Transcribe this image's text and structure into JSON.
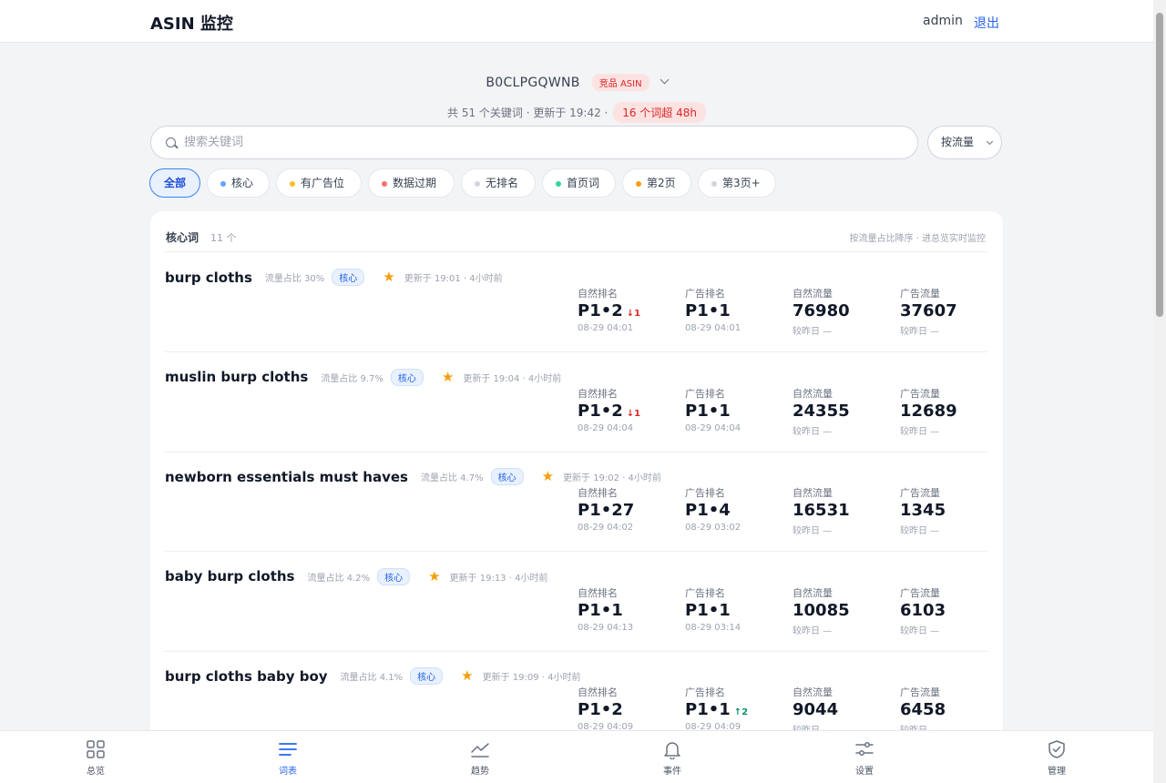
{
  "header": {
    "title": "ASIN 监控",
    "user": "admin",
    "logout_label": "退出"
  },
  "asin": {
    "code": "B0CLPGQWNB",
    "badge": "竞品 ASIN"
  },
  "summary": {
    "text": "共 51 个关键词 · 更新于 19:42 ·",
    "overdue": "16 个词超 48h"
  },
  "search": {
    "placeholder": "搜索关键词"
  },
  "sort": {
    "label": "按流量"
  },
  "filters": [
    {
      "label": "全部",
      "dot": "",
      "active": true
    },
    {
      "label": "核心",
      "dot": "#60a5fa"
    },
    {
      "label": "有广告位",
      "dot": "#fbbf24"
    },
    {
      "label": "数据过期",
      "dot": "#f87171"
    },
    {
      "label": "无排名",
      "dot": "#d1d5db"
    },
    {
      "label": "首页词",
      "dot": "#34d399"
    },
    {
      "label": "第2页",
      "dot": "#f59e0b"
    },
    {
      "label": "第3页+",
      "dot": "#d1d5db"
    }
  ],
  "section": {
    "title": "核心词",
    "count": "11 个",
    "hint": "按流量占比降序 · 进总览实时监控"
  },
  "columns": {
    "natural_rank": "自然排名",
    "ad_rank": "广告排名",
    "natural_traffic": "自然流量",
    "ad_traffic": "广告流量"
  },
  "keywords": [
    {
      "name": "burp cloths",
      "share": "流量占比 30%",
      "tag": "核心",
      "updated": "更新于 19:01 · 4小时前",
      "natural_rank": "P1•2",
      "natural_delta": "↓1",
      "natural_delta_dir": "down",
      "natural_time": "08-29 04:01",
      "ad_rank": "P1•1",
      "ad_delta": "",
      "ad_delta_dir": "",
      "ad_time": "08-29 04:01",
      "natural_traffic": "76980",
      "natural_traffic_sub": "较昨日 —",
      "ad_traffic": "37607",
      "ad_traffic_sub": "较昨日 —"
    },
    {
      "name": "muslin burp cloths",
      "share": "流量占比 9.7%",
      "tag": "核心",
      "updated": "更新于 19:04 · 4小时前",
      "natural_rank": "P1•2",
      "natural_delta": "↓1",
      "natural_delta_dir": "down",
      "natural_time": "08-29 04:04",
      "ad_rank": "P1•1",
      "ad_delta": "",
      "ad_delta_dir": "",
      "ad_time": "08-29 04:04",
      "natural_traffic": "24355",
      "natural_traffic_sub": "较昨日 —",
      "ad_traffic": "12689",
      "ad_traffic_sub": "较昨日 —"
    },
    {
      "name": "newborn essentials must haves",
      "share": "流量占比 4.7%",
      "tag": "核心",
      "updated": "更新于 19:02 · 4小时前",
      "natural_rank": "P1•27",
      "natural_delta": "",
      "natural_delta_dir": "",
      "natural_time": "08-29 04:02",
      "ad_rank": "P1•4",
      "ad_delta": "",
      "ad_delta_dir": "",
      "ad_time": "08-29 03:02",
      "natural_traffic": "16531",
      "natural_traffic_sub": "较昨日 —",
      "ad_traffic": "1345",
      "ad_traffic_sub": "较昨日 —"
    },
    {
      "name": "baby burp cloths",
      "share": "流量占比 4.2%",
      "tag": "核心",
      "updated": "更新于 19:13 · 4小时前",
      "natural_rank": "P1•1",
      "natural_delta": "",
      "natural_delta_dir": "",
      "natural_time": "08-29 04:13",
      "ad_rank": "P1•1",
      "ad_delta": "",
      "ad_delta_dir": "",
      "ad_time": "08-29 03:14",
      "natural_traffic": "10085",
      "natural_traffic_sub": "较昨日 —",
      "ad_traffic": "6103",
      "ad_traffic_sub": "较昨日 —"
    },
    {
      "name": "burp cloths baby boy",
      "share": "流量占比 4.1%",
      "tag": "核心",
      "updated": "更新于 19:09 · 4小时前",
      "natural_rank": "P1•2",
      "natural_delta": "",
      "natural_delta_dir": "",
      "natural_time": "08-29 04:09",
      "ad_rank": "P1•1",
      "ad_delta": "↑2",
      "ad_delta_dir": "up",
      "ad_time": "08-29 04:09",
      "natural_traffic": "9044",
      "natural_traffic_sub": "较昨日 —",
      "ad_traffic": "6458",
      "ad_traffic_sub": "较昨日 —"
    }
  ],
  "nav": [
    {
      "label": "总览",
      "icon": "grid-icon"
    },
    {
      "label": "词表",
      "icon": "list-icon",
      "active": true
    },
    {
      "label": "趋势",
      "icon": "trend-icon"
    },
    {
      "label": "事件",
      "icon": "bell-icon"
    },
    {
      "label": "设置",
      "icon": "sliders-icon"
    },
    {
      "label": "管理",
      "icon": "shield-icon"
    }
  ]
}
